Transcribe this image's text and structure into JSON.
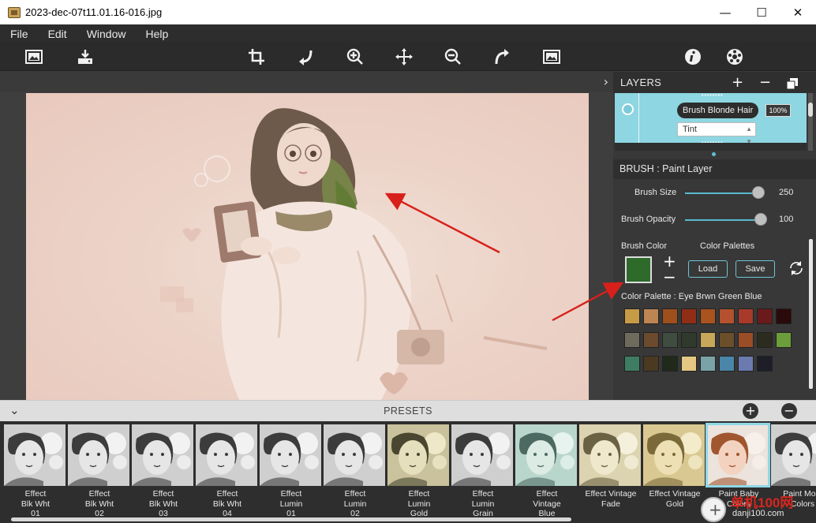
{
  "window": {
    "title": "2023-dec-07t11.01.16-016.jpg",
    "minimize": "—",
    "maximize": "☐",
    "close": "✕"
  },
  "menu": [
    "File",
    "Edit",
    "Window",
    "Help"
  ],
  "toolbar": {
    "icons": [
      "open-image-icon",
      "save-icon",
      "crop-icon",
      "undo-icon",
      "zoom-in-icon",
      "move-icon",
      "zoom-out-icon",
      "redo-icon",
      "fit-image-icon",
      "info-icon",
      "settings-icon"
    ]
  },
  "canvas": {
    "collapse_icon": "›"
  },
  "layers": {
    "title": "LAYERS",
    "add": "+",
    "remove": "−",
    "layer_name": "Brush Blonde Hair",
    "layer_opacity": "100%",
    "blend_mode": "Tint",
    "dots": "••••••••"
  },
  "brush": {
    "header": "BRUSH : Paint Layer",
    "size_label": "Brush Size",
    "size_value": "250",
    "size_fraction": 0.97,
    "opacity_label": "Brush Opacity",
    "opacity_value": "100",
    "opacity_fraction": 1.0,
    "color_label": "Brush Color",
    "color": "#2e6b2b",
    "palettes_label": "Color Palettes",
    "load": "Load",
    "save": "Save",
    "plus": "+",
    "minus": "−",
    "palette_name": "Color Palette : Eye Brwn Green Blue",
    "palette_colors": [
      "#c79a45",
      "#bd8552",
      "#9e4f1c",
      "#8f2d16",
      "#a9531e",
      "#b4512e",
      "#a83a2b",
      "#6a1a1a",
      "#2a0a0a",
      "#6f6b5c",
      "#6b4a2e",
      "#3e4d40",
      "#2f3a2c",
      "#c8a75a",
      "#6b4e2a",
      "#9b4d26",
      "#2b2b1f",
      "#6b9e3a",
      "#3e7d64",
      "#4a3a22",
      "#1f2a1a",
      "#e3c783",
      "#7aa3a8",
      "#4a86a8",
      "#6b7bb0",
      "#1e1e28"
    ]
  },
  "presets": {
    "title": "PRESETS",
    "collapse": "⌄",
    "add": "+",
    "remove": "−",
    "items": [
      {
        "label": "Effect\nBlk Wht\n01",
        "tone": "bw"
      },
      {
        "label": "Effect\nBlk Wht\n02",
        "tone": "bw"
      },
      {
        "label": "Effect\nBlk Wht\n03",
        "tone": "bw"
      },
      {
        "label": "Effect\nBlk Wht\n04",
        "tone": "bw"
      },
      {
        "label": "Effect\nLumin\n01",
        "tone": "bw"
      },
      {
        "label": "Effect\nLumin\n02",
        "tone": "bw"
      },
      {
        "label": "Effect\nLumin\nGold",
        "tone": "gold"
      },
      {
        "label": "Effect\nLumin\nGrain",
        "tone": "bw"
      },
      {
        "label": "Effect\nVintage\nBlue",
        "tone": "blue"
      },
      {
        "label": "Effect Vintage\nFade",
        "tone": "fade"
      },
      {
        "label": "Effect Vintage\nGold",
        "tone": "vgold"
      },
      {
        "label": "Paint Baby\nColors",
        "tone": "color"
      },
      {
        "label": "Paint Most\nColors",
        "tone": "bw"
      }
    ]
  },
  "watermark": {
    "line1": "单机100网",
    "line2": "danji100.com"
  }
}
